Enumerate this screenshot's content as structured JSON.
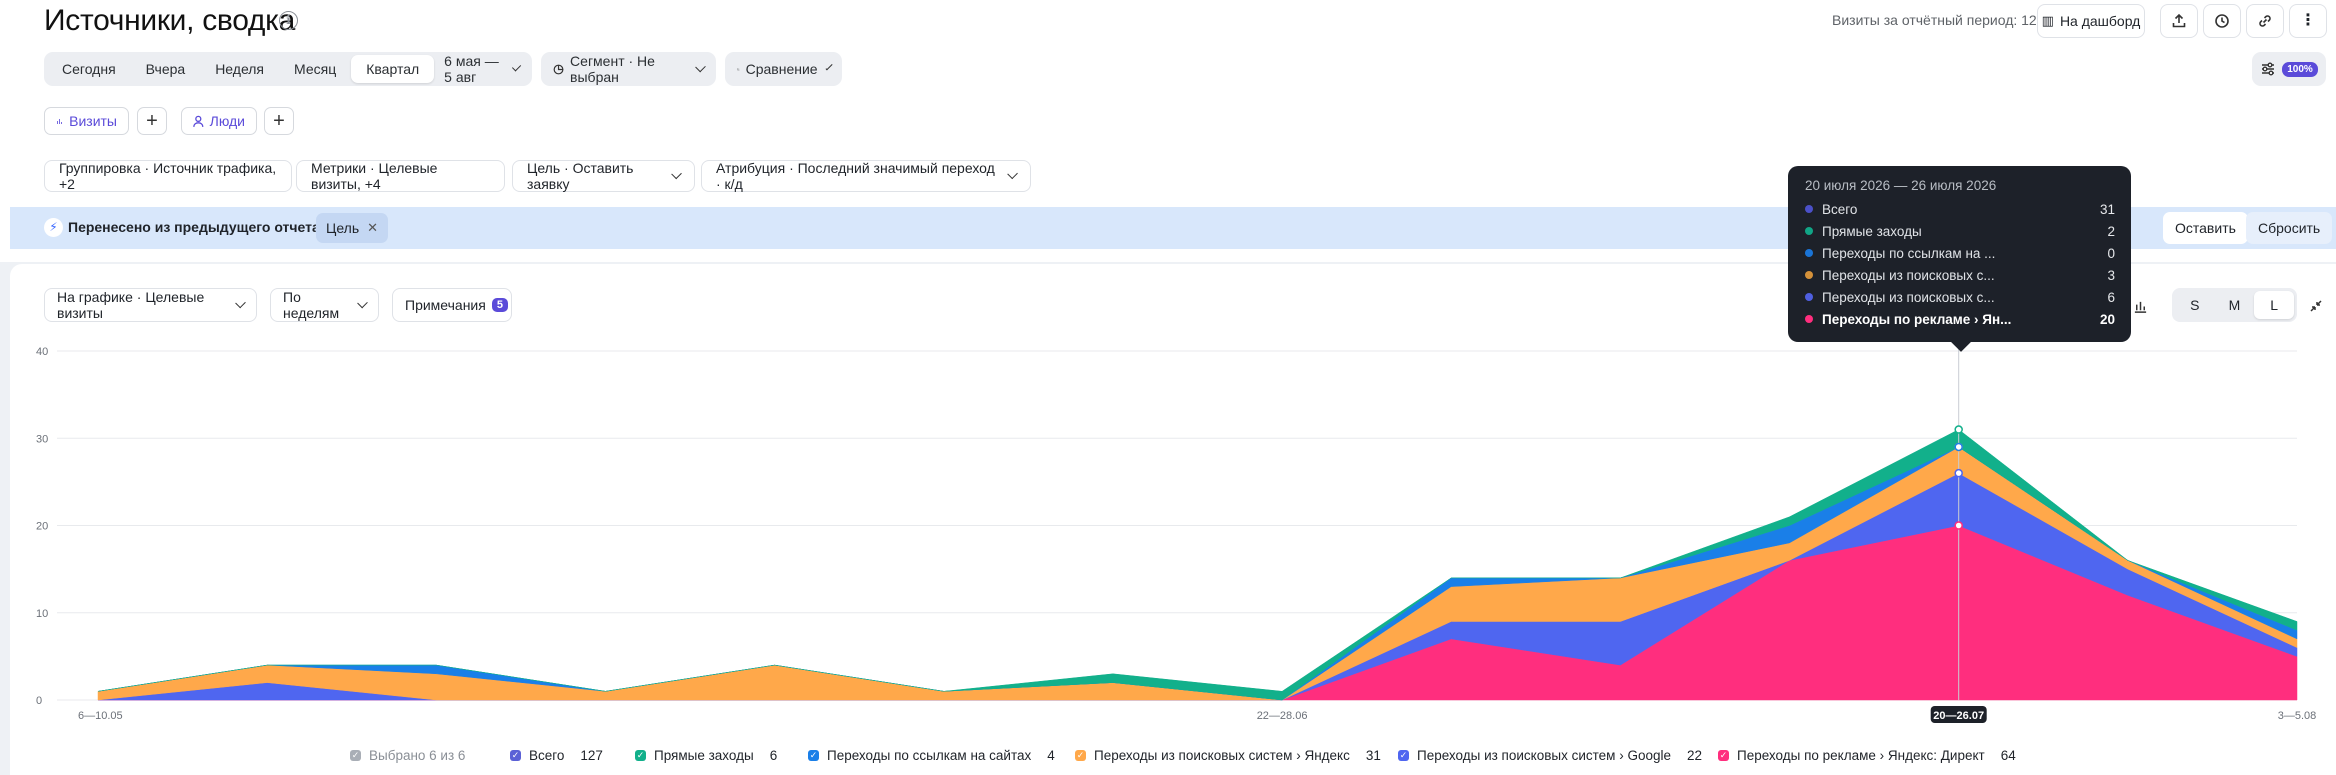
{
  "header": {
    "title": "Источники, сводка",
    "visits_period": "Визиты за отчётный период: 127",
    "dashboard_label": "На дашборд"
  },
  "period": {
    "tabs": [
      "Сегодня",
      "Вчера",
      "Неделя",
      "Месяц",
      "Квартал"
    ],
    "active": "Квартал",
    "date_range": "6 мая — 5 авг"
  },
  "segment": {
    "label": "Сегмент · Не выбран"
  },
  "compare": {
    "label": "Сравнение"
  },
  "settings": {
    "badge": "100%"
  },
  "segments": {
    "visits": "Визиты",
    "people": "Люди"
  },
  "filters": {
    "grouping": "Группировка · Источник трафика, +2",
    "metrics": "Метрики · Целевые визиты, +4",
    "goal": "Цель · Оставить заявку",
    "attribution": "Атрибуция · Последний значимый переход · к/д"
  },
  "transfer": {
    "text": "Перенесено из предыдущего отчета",
    "tag": "Цель",
    "keep": "Оставить",
    "reset": "Сбросить"
  },
  "chart_controls": {
    "on_chart": "На графике · Целевые визиты",
    "by_weeks": "По неделям",
    "notes": "Примечания",
    "notes_count": "5",
    "sizes": [
      "S",
      "M",
      "L"
    ],
    "active_size": "L"
  },
  "tooltip": {
    "date": "20 июля 2026 — 26 июля 2026",
    "rows": [
      {
        "label": "Всего",
        "value": "31",
        "color": "#4b50c8"
      },
      {
        "label": "Прямые заходы",
        "value": "2",
        "color": "#11a586"
      },
      {
        "label": "Переходы по ссылкам на ...",
        "value": "0",
        "color": "#1a74d6"
      },
      {
        "label": "Переходы из поисковых с...",
        "value": "3",
        "color": "#d4913a"
      },
      {
        "label": "Переходы из поисковых с...",
        "value": "6",
        "color": "#4f5fe0"
      },
      {
        "label": "Переходы по рекламе › Ян...",
        "value": "20",
        "color": "#ff2e7e"
      }
    ]
  },
  "legend": {
    "selected": "Выбрано 6 из 6",
    "items": [
      {
        "label": "Всего",
        "count": "127",
        "color": "#5b61d6"
      },
      {
        "label": "Прямые заходы",
        "count": "6",
        "color": "#12b08b"
      },
      {
        "label": "Переходы по ссылкам на сайтах",
        "count": "4",
        "color": "#1a7fe8"
      },
      {
        "label": "Переходы из поисковых систем › Яндекс",
        "count": "31",
        "color": "#ffa84a"
      },
      {
        "label": "Переходы из поисковых систем › Google",
        "count": "22",
        "color": "#4f66f0"
      },
      {
        "label": "Переходы по рекламе › Яндекс: Директ",
        "count": "64",
        "color": "#ff2e7e"
      }
    ]
  },
  "chart_data": {
    "type": "area",
    "stacked": true,
    "x": [
      "6—10.05",
      "11—17.05",
      "18—24.05",
      "25—31.05",
      "1—7.06",
      "8—14.06",
      "15—21.06",
      "22—28.06",
      "29.06—5.07",
      "6—12.07",
      "13—19.07",
      "20—26.07",
      "27.07—2.08",
      "3—5.08"
    ],
    "x_tick_labels": [
      "6—10.05",
      "22—28.06",
      "20—26.07",
      "3—5.08"
    ],
    "highlight_x": "20—26.07",
    "ylim": [
      0,
      40
    ],
    "yticks": [
      0,
      10,
      20,
      30,
      40
    ],
    "grid": true,
    "series": [
      {
        "name": "Переходы по рекламе › Яндекс: Директ",
        "color": "#ff2e7e",
        "values": [
          0,
          0,
          0,
          0,
          0,
          0,
          0,
          0,
          7,
          4,
          16,
          20,
          12,
          5
        ]
      },
      {
        "name": "Переходы из поисковых систем › Google",
        "color": "#4f66f0",
        "values": [
          0,
          2,
          0,
          0,
          0,
          0,
          0,
          0,
          2,
          5,
          0,
          6,
          3,
          1
        ]
      },
      {
        "name": "Переходы из поисковых систем › Яндекс",
        "color": "#ffa84a",
        "values": [
          1,
          2,
          3,
          1,
          4,
          1,
          2,
          0,
          4,
          5,
          2,
          3,
          1,
          1
        ]
      },
      {
        "name": "Переходы по ссылкам на сайтах",
        "color": "#1a7fe8",
        "values": [
          0,
          0,
          1,
          0,
          0,
          0,
          0,
          0,
          1,
          0,
          2,
          0,
          0,
          1
        ]
      },
      {
        "name": "Прямые заходы",
        "color": "#12b08b",
        "values": [
          0,
          0,
          0,
          0,
          0,
          0,
          1,
          1,
          0,
          0,
          1,
          2,
          0,
          1
        ]
      }
    ]
  }
}
